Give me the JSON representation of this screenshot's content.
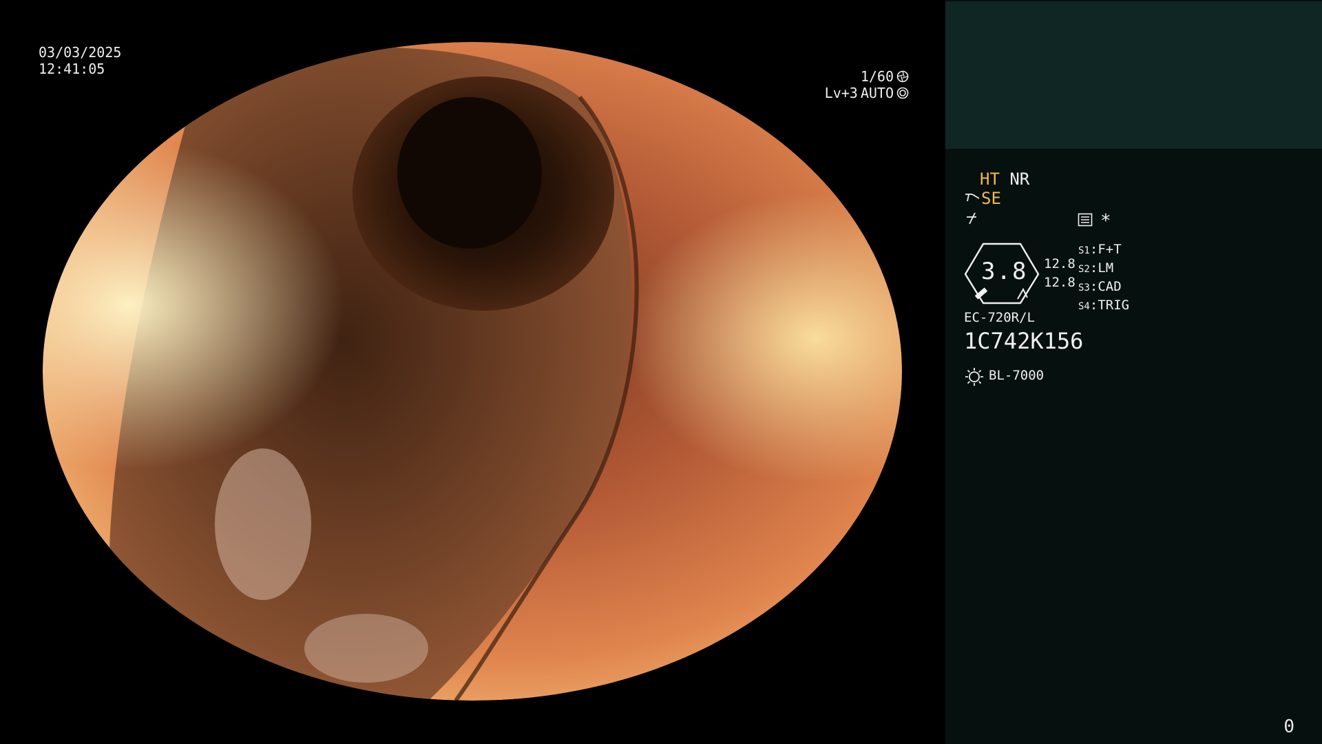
{
  "osd": {
    "date": "03/03/2025",
    "time": "12:41:05",
    "shutter": "1/60",
    "level": "Lv+3",
    "iris_mode": "AUTO"
  },
  "panel": {
    "mode_ht": "HT",
    "mode_nr": "NR",
    "mode_se": "SE",
    "star": "*",
    "gauge_value": "3.8",
    "gauge_side_top": "12.8",
    "gauge_side_bottom": "12.8",
    "switches": [
      {
        "key": "S1",
        "value": "F+T"
      },
      {
        "key": "S2",
        "value": "LM"
      },
      {
        "key": "S3",
        "value": "CAD"
      },
      {
        "key": "S4",
        "value": "TRIG"
      }
    ],
    "scope_model": "EC-720R/L",
    "scope_serial": "1C742K156",
    "light_source": "BL-7000",
    "frame_counter": "0"
  },
  "colors": {
    "panel_bg": "#06100f",
    "patient_box_bg": "#0f2624",
    "amber": "#f2b84a",
    "text": "#f0f0f0"
  },
  "icons": [
    "shutter-icon",
    "iris-icon",
    "scope-tip-icon",
    "zap-icon",
    "menu-icon",
    "lamp-icon",
    "gauge-icon"
  ]
}
